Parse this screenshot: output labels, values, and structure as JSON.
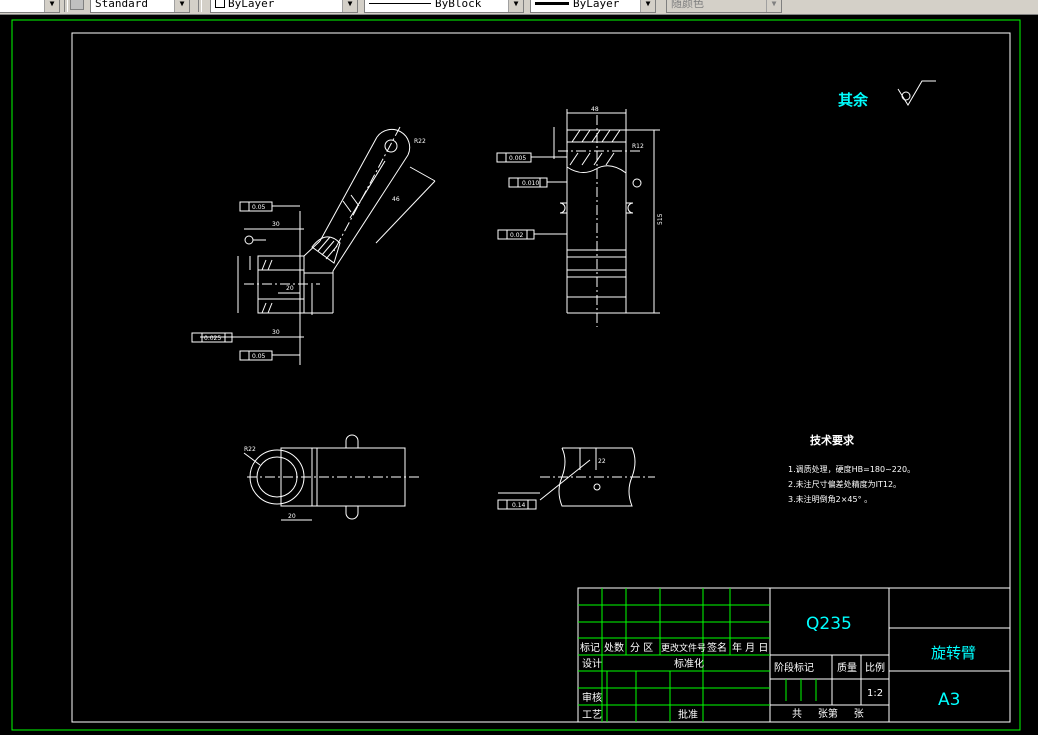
{
  "toolbar": {
    "text_style": "Standard",
    "layer": "ByLayer",
    "linetype": "ByBlock",
    "lineweight": "ByLayer",
    "plot_style": "随颜色"
  },
  "drawing": {
    "roughness_label": "其余",
    "tech_requirements": {
      "title": "技术要求",
      "items": [
        "1.调质处理，硬度HB=180~220。",
        "2.未注尺寸偏差处精度为IT12。",
        "3.未注明倒角2×45°  。"
      ]
    },
    "annotations": {
      "left_ft1": "0.05",
      "left_ft2": "0.025",
      "left_ft3": "0.05",
      "right_ft1": "0.005",
      "right_ft2": "0.010",
      "right_ft3": "0.02",
      "bottom_ft": "0.14",
      "dim_50a": "50",
      "dim_50b": "50",
      "dim_48": "48",
      "dim_515": "515",
      "dim_46": "46",
      "dim_22": "22",
      "dim_r22": "R22",
      "dim_r12": "R12",
      "dim_30": "30",
      "dim_20": "20"
    }
  },
  "title_block": {
    "material": "Q235",
    "part_name": "旋转臂",
    "paper_size": "A3",
    "scale": "1:2",
    "header_labels": [
      "标记",
      "处数",
      "分  区",
      "更改文件号",
      "签名",
      "年  月  日"
    ],
    "design": "设计",
    "standardize": "标准化",
    "stage_mark": "阶段标记",
    "mass": "质量",
    "ratio": "比例",
    "review": "审核",
    "process": "工艺",
    "approve": "批准",
    "sheets": "共     张第     张"
  }
}
